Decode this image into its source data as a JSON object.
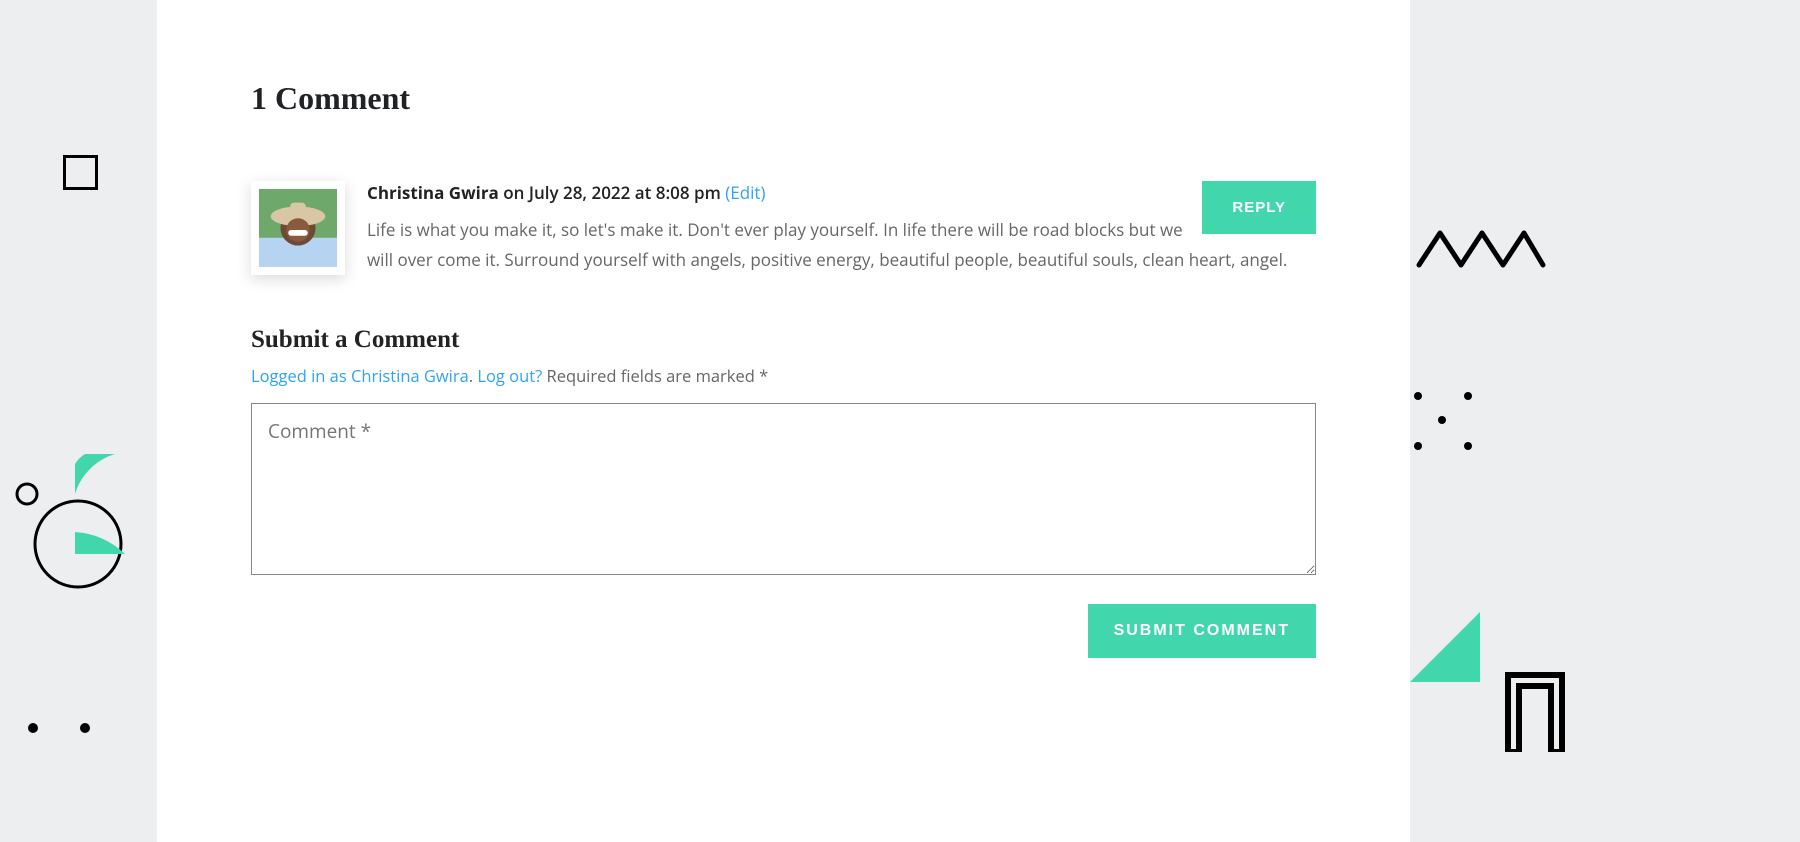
{
  "comments": {
    "title": "1 Comment",
    "items": [
      {
        "author": "Christina Gwira",
        "date": "on July 28, 2022 at 8:08 pm",
        "edit_label": "(Edit)",
        "body": "Life is what you make it, so let's make it. Don't ever play yourself. In life there will be road blocks but we will over come it. Surround yourself with angels, positive energy, beautiful people, beautiful souls, clean heart, angel.",
        "reply_label": "REPLY"
      }
    ]
  },
  "form": {
    "title": "Submit a Comment",
    "logged_in_prefix": "Logged in as Christina Gwira",
    "logout_label": "Log out?",
    "required_note": " Required fields are marked *",
    "dot": ". ",
    "placeholder": "Comment *",
    "submit_label": "SUBMIT COMMENT"
  },
  "colors": {
    "accent": "#41d6ac",
    "link": "#2ea3f2"
  }
}
